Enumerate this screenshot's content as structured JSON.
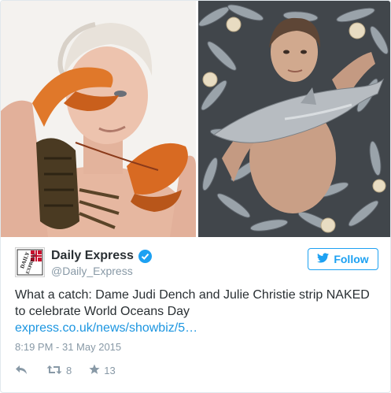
{
  "account": {
    "name": "Daily Express",
    "handle": "@Daily_Express",
    "avatar_text_top": "DAILY",
    "avatar_text_bottom": "EXPRESS"
  },
  "follow_button": {
    "label": "Follow"
  },
  "tweet": {
    "text": "What a catch: Dame Judi Dench and Julie Christie strip NAKED to celebrate World Oceans Day",
    "link": "express.co.uk/news/showbiz/5…",
    "timestamp": "8:19 PM - 31 May 2015"
  },
  "stats": {
    "retweets": "8",
    "likes": "13"
  },
  "icons": {
    "verified": "verified-badge-icon",
    "follow": "bird-icon",
    "reply": "reply-icon",
    "retweet": "retweet-icon",
    "like": "star-icon"
  },
  "colors": {
    "accent": "#1da1f2",
    "link": "#1b95e0",
    "muted": "#8899a6",
    "text": "#292f33"
  }
}
